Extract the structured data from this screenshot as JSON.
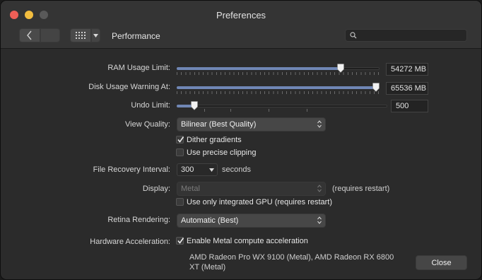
{
  "window": {
    "title": "Preferences"
  },
  "toolbar": {
    "section_title": "Performance",
    "search_placeholder": ""
  },
  "prefs": {
    "ram": {
      "label": "RAM Usage Limit:",
      "value": "54272 MB",
      "level": 0.82
    },
    "disk": {
      "label": "Disk Usage Warning At:",
      "value": "65536 MB",
      "level": 1.0
    },
    "undo": {
      "label": "Undo Limit:",
      "value": "500",
      "level": 0.07
    },
    "view_quality": {
      "label": "View Quality:",
      "value": "Bilinear (Best Quality)"
    },
    "dither": {
      "label": "Dither gradients",
      "checked": true
    },
    "precise_clipping": {
      "label": "Use precise clipping",
      "checked": false
    },
    "file_recovery": {
      "label": "File Recovery Interval:",
      "value": "300",
      "unit": "seconds"
    },
    "display": {
      "label": "Display:",
      "value": "Metal",
      "note": "(requires restart)"
    },
    "integrated_gpu": {
      "label": "Use only integrated GPU (requires restart)",
      "checked": false
    },
    "retina": {
      "label": "Retina Rendering:",
      "value": "Automatic (Best)"
    },
    "hw_accel": {
      "label": "Hardware Acceleration:",
      "option_label": "Enable Metal compute acceleration",
      "checked": true
    },
    "gpu_list": "AMD Radeon Pro WX 9100 (Metal), AMD Radeon RX 6800 XT (Metal)"
  },
  "buttons": {
    "close_label": "Close"
  },
  "icons": {
    "back": "chevron-left-icon",
    "grid": "grid-icon",
    "search": "search-icon"
  },
  "colors": {
    "accent": "#7087b5",
    "close": "#ee5f57",
    "minimize": "#f2bd3f"
  }
}
